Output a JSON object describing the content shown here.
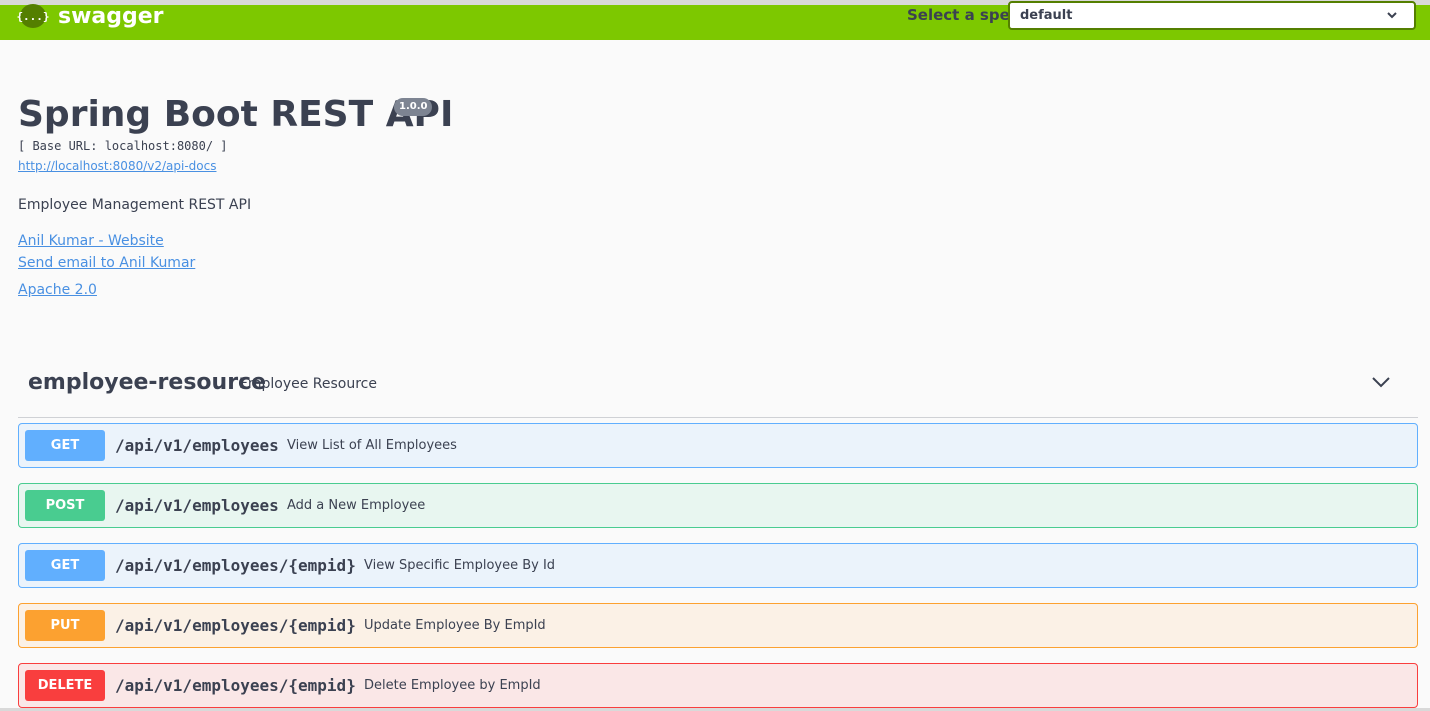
{
  "topbar": {
    "logo_glyph": "{...}",
    "logo_text": "swagger",
    "spec_label": "Select a spec",
    "spec_value": "default",
    "brand_color": "#7dc800"
  },
  "info": {
    "title": "Spring Boot REST API",
    "version": "1.0.0",
    "base_url": "[ Base URL: localhost:8080/ ]",
    "api_docs_link": "http://localhost:8080/v2/api-docs",
    "description": "Employee Management REST API",
    "website_link": "Anil Kumar - Website",
    "email_link": "Send email to Anil Kumar",
    "license_link": "Apache 2.0"
  },
  "tag": {
    "name": "employee-resource",
    "description": "Employee Resource"
  },
  "operations": [
    {
      "method": "GET",
      "path": "/api/v1/employees",
      "summary": "View List of All Employees",
      "color": "#61affe"
    },
    {
      "method": "POST",
      "path": "/api/v1/employees",
      "summary": "Add a New Employee",
      "color": "#49cc90"
    },
    {
      "method": "GET",
      "path": "/api/v1/employees/{empid}",
      "summary": "View Specific Employee By Id",
      "color": "#61affe"
    },
    {
      "method": "PUT",
      "path": "/api/v1/employees/{empid}",
      "summary": "Update Employee By EmpId",
      "color": "#fca130"
    },
    {
      "method": "DELETE",
      "path": "/api/v1/employees/{empid}",
      "summary": "Delete Employee by EmpId",
      "color": "#f93e3e"
    }
  ]
}
